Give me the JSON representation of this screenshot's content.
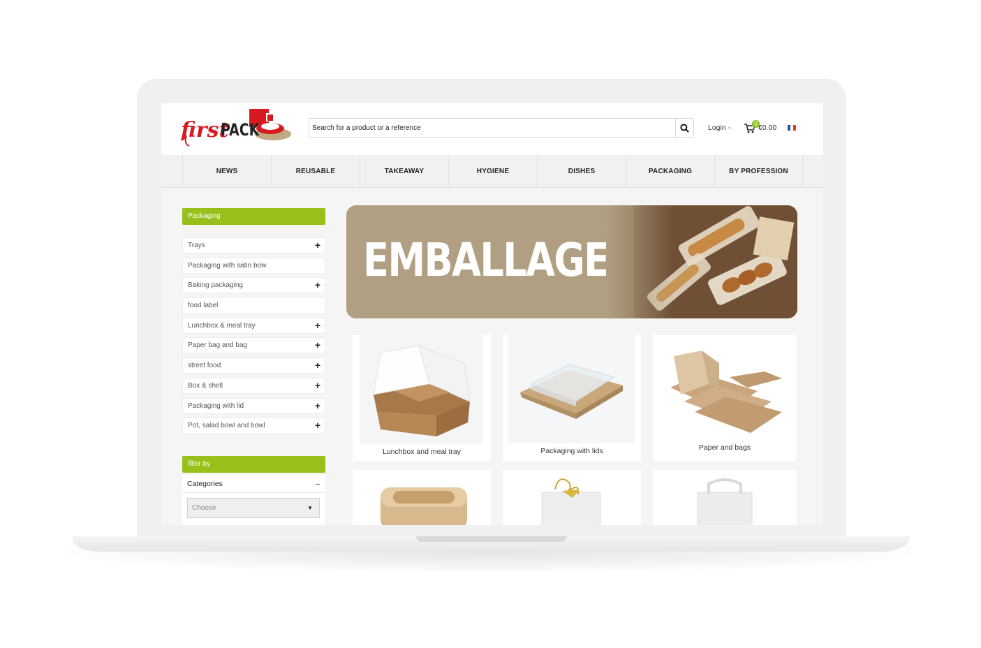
{
  "header": {
    "search_placeholder": "Search for a product or a reference",
    "login_label": "Login",
    "cart_count": "0",
    "cart_total": "€0.00",
    "language_flag": "fr-flag-icon"
  },
  "nav": {
    "items": [
      "NEWS",
      "REUSABLE",
      "TAKEAWAY",
      "HYGIENE",
      "DISHES",
      "PACKAGING",
      "BY PROFESSION"
    ]
  },
  "sidebar": {
    "title": "Packaging",
    "items": [
      {
        "label": "Trays",
        "expandable": true
      },
      {
        "label": "Packaging with satin bow",
        "expandable": false
      },
      {
        "label": "Baking packaging",
        "expandable": true
      },
      {
        "label": "food label",
        "expandable": false
      },
      {
        "label": "Lunchbox & meal tray",
        "expandable": true
      },
      {
        "label": "Paper bag and bag",
        "expandable": true
      },
      {
        "label": "street food",
        "expandable": true
      },
      {
        "label": "Box & shell",
        "expandable": true
      },
      {
        "label": "Packaging with lid",
        "expandable": true
      },
      {
        "label": "Pot, salad bowl and bowl",
        "expandable": true
      }
    ],
    "filter_title": "filter by",
    "filter_category_label": "Categories",
    "select_value": "Choose"
  },
  "banner": {
    "title": "EMBALLAGE"
  },
  "products": [
    {
      "label": "Lunchbox and meal tray"
    },
    {
      "label": "Packaging with lids"
    },
    {
      "label": "Paper and bags"
    },
    {
      "label": ""
    },
    {
      "label": ""
    },
    {
      "label": ""
    }
  ],
  "colors": {
    "accent_green": "#97c01a",
    "logo_red": "#d71920",
    "banner_tan": "#b09f82"
  }
}
